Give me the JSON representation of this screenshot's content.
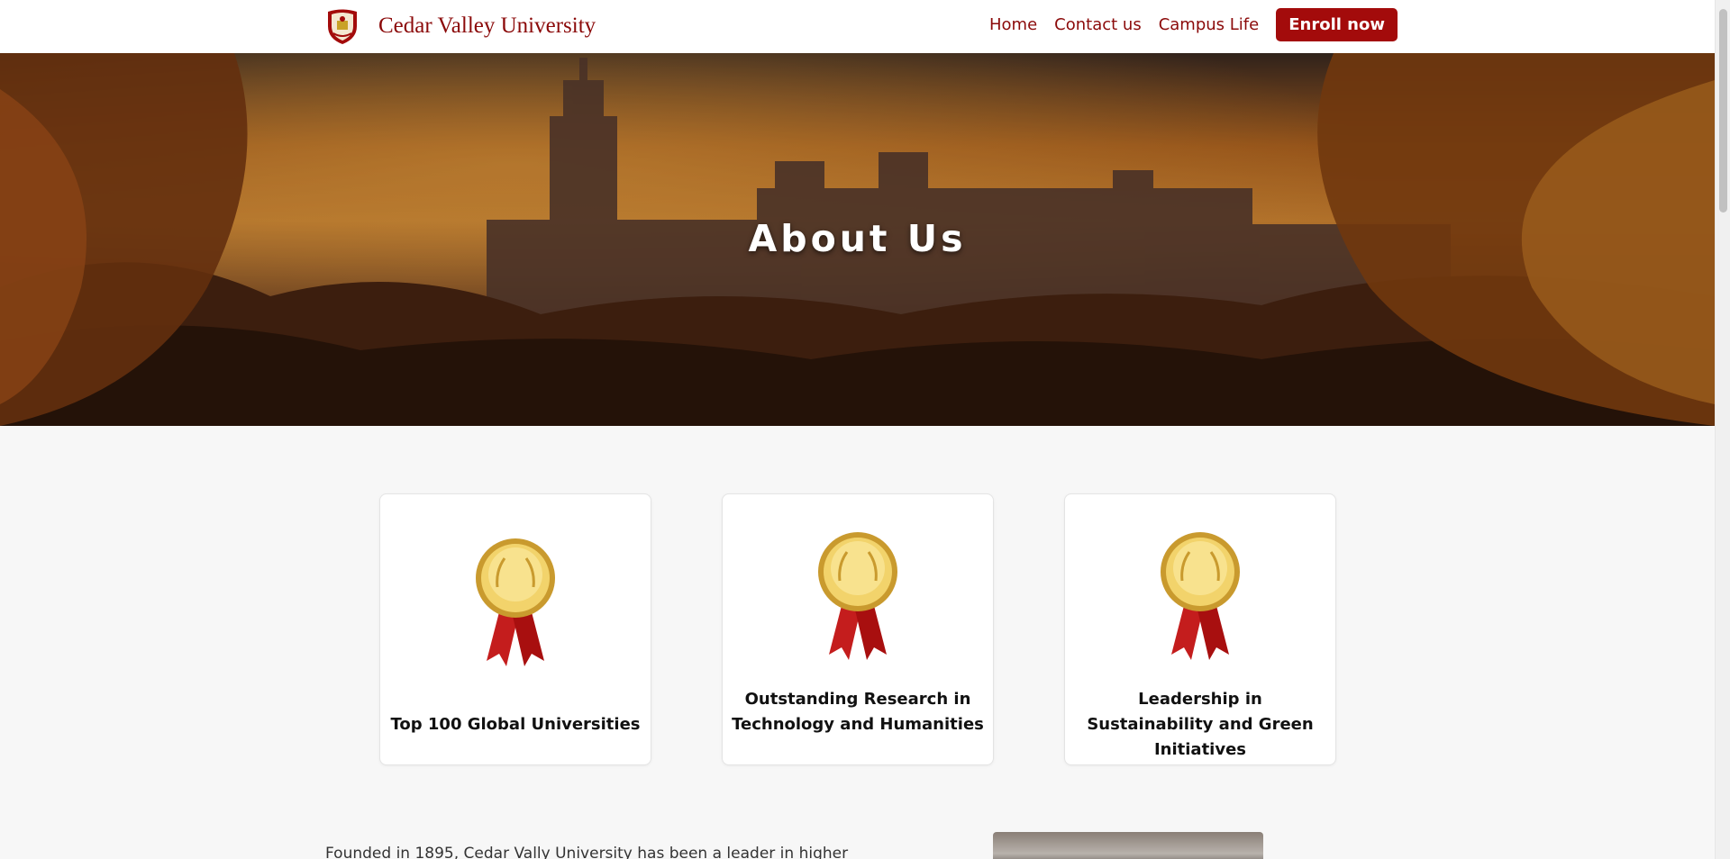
{
  "header": {
    "brand_name": "Cedar Valley University",
    "nav": [
      "Home",
      "Contact us",
      "Campus Life"
    ],
    "enroll_label": "Enroll now"
  },
  "hero": {
    "title": "About Us"
  },
  "awards": [
    {
      "title": "Top 100 Global Universities"
    },
    {
      "title": "Outstanding Research in Technology and Humanities"
    },
    {
      "title": "Leadership in Sustainability and Green Initiatives"
    }
  ],
  "about": {
    "intro_text": "Founded in 1895, Cedar Vally University has been a leader in higher"
  },
  "colors": {
    "brand": "#8b0a0a",
    "button": "#a30b0b",
    "background": "#f7f7f7"
  },
  "icons": {
    "crest": "university-crest-icon",
    "medal": "gold-medal-icon"
  }
}
